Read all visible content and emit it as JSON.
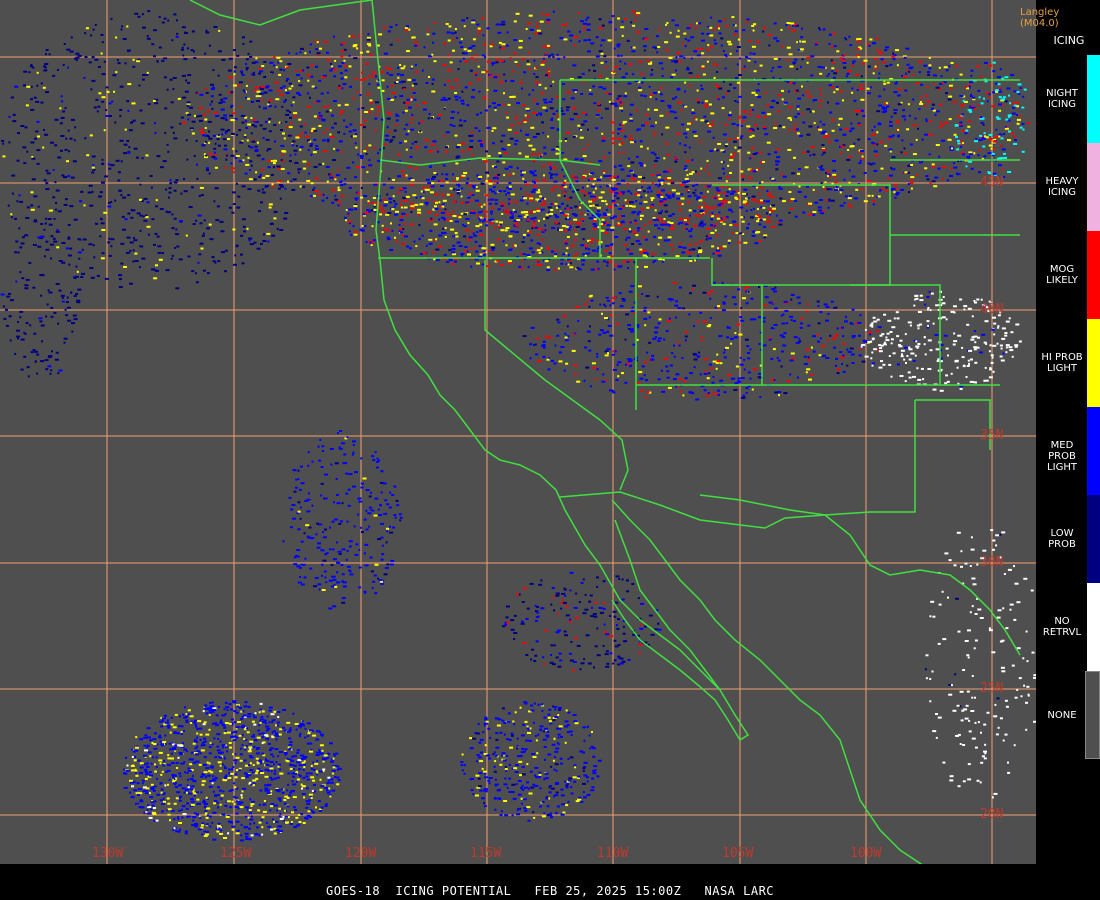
{
  "credit": "Langley (M04.0)",
  "footer": "GOES-18  ICING POTENTIAL   FEB 25, 2025 15:00Z   NASA LARC",
  "legend": {
    "title": "ICING",
    "items": [
      {
        "label": "NIGHT\nICING",
        "color": "#00ffff"
      },
      {
        "label": "HEAVY\nICING",
        "color": "#f0b0e0"
      },
      {
        "label": "MOG\nLIKELY",
        "color": "#ff0000"
      },
      {
        "label": "HI PROB\nLIGHT",
        "color": "#ffff00"
      },
      {
        "label": "MED PROB\nLIGHT",
        "color": "#0000ff"
      },
      {
        "label": "LOW\nPROB",
        "color": "#000080"
      },
      {
        "label": "NO\nRETRVL",
        "color": "#ffffff"
      },
      {
        "label": "NONE",
        "color": "#4f4f4f"
      }
    ]
  },
  "grid": {
    "latitudes": [
      "45N",
      "40N",
      "35N",
      "30N",
      "25N",
      "20N"
    ],
    "longitudes": [
      "130W",
      "125W",
      "120W",
      "115W",
      "110W",
      "105W",
      "100W"
    ],
    "line_color": "#f0a070"
  },
  "colors": {
    "coastline": "#40e040",
    "background": "#4f4f4f"
  }
}
